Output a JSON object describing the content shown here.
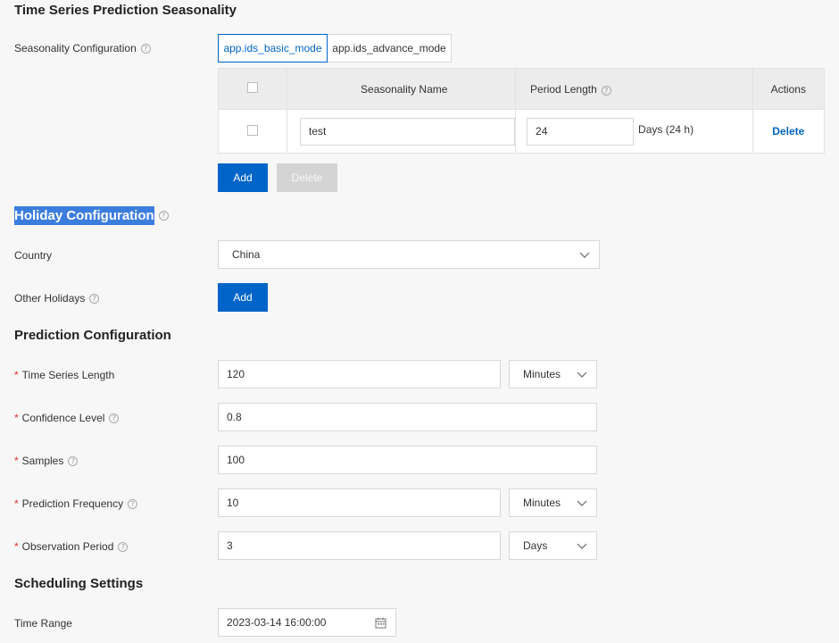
{
  "seasonality": {
    "title": "Time Series Prediction Seasonality",
    "config_label": "Seasonality Configuration",
    "tabs": [
      "app.ids_basic_mode",
      "app.ids_advance_mode"
    ],
    "table": {
      "headers": [
        "Seasonality Name",
        "Period Length",
        "Actions"
      ],
      "rows": [
        {
          "name": "test",
          "period": "24",
          "unit": "Days (24 h)",
          "action": "Delete"
        }
      ]
    },
    "add_label": "Add",
    "delete_label": "Delete"
  },
  "holiday": {
    "title": "Holiday Configuration",
    "country_label": "Country",
    "country_value": "China",
    "other_label": "Other Holidays",
    "add_label": "Add"
  },
  "prediction": {
    "title": "Prediction Configuration",
    "ts_length_label": "Time Series Length",
    "ts_length_value": "120",
    "ts_length_unit": "Minutes",
    "confidence_label": "Confidence Level",
    "confidence_value": "0.8",
    "samples_label": "Samples",
    "samples_value": "100",
    "frequency_label": "Prediction Frequency",
    "frequency_value": "10",
    "frequency_unit": "Minutes",
    "observation_label": "Observation Period",
    "observation_value": "3",
    "observation_unit": "Days"
  },
  "scheduling": {
    "title": "Scheduling Settings",
    "time_range_label": "Time Range",
    "time_range_value": "2023-03-14 16:00:00"
  },
  "colors": {
    "primary": "#0064c8",
    "required": "#e62e2e",
    "highlight": "#3b7ddd"
  }
}
